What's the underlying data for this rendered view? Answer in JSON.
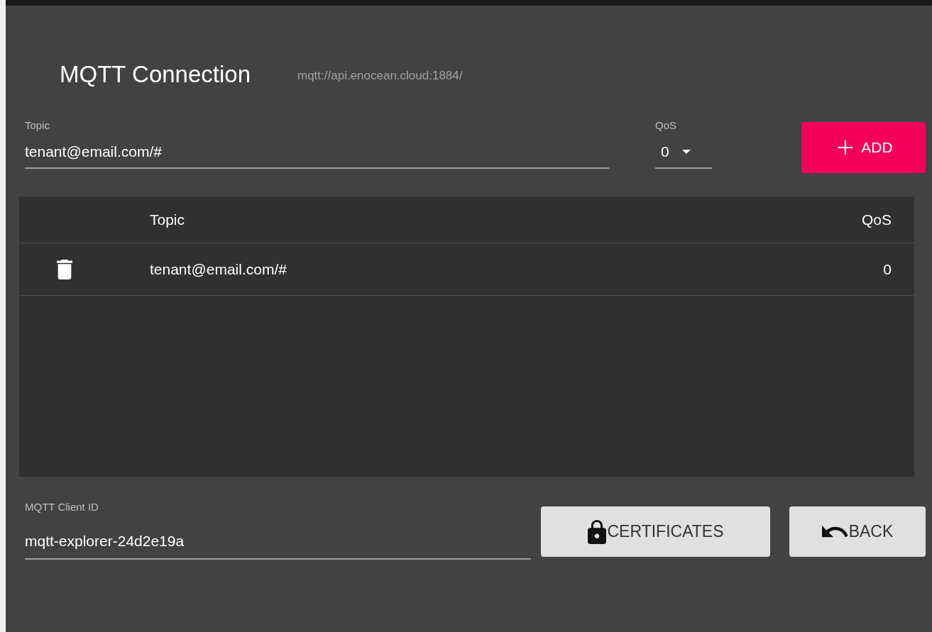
{
  "header": {
    "title": "MQTT Connection",
    "url": "mqtt://api.enocean.cloud:1884/"
  },
  "topic_field": {
    "label": "Topic",
    "value": "tenant@email.com/#"
  },
  "qos_select": {
    "label": "QoS",
    "value": "0"
  },
  "add_button": {
    "label": "ADD"
  },
  "subscriptions": {
    "columns": [
      "Topic",
      "QoS"
    ],
    "rows": [
      {
        "topic": "tenant@email.com/#",
        "qos": "0"
      }
    ]
  },
  "client_id_field": {
    "label": "MQTT Client ID",
    "value": "mqtt-explorer-24d2e19a"
  },
  "buttons": [
    {
      "label": "CERTIFICATES",
      "kind": "certificates"
    },
    {
      "label": "BACK",
      "kind": "back"
    }
  ]
}
